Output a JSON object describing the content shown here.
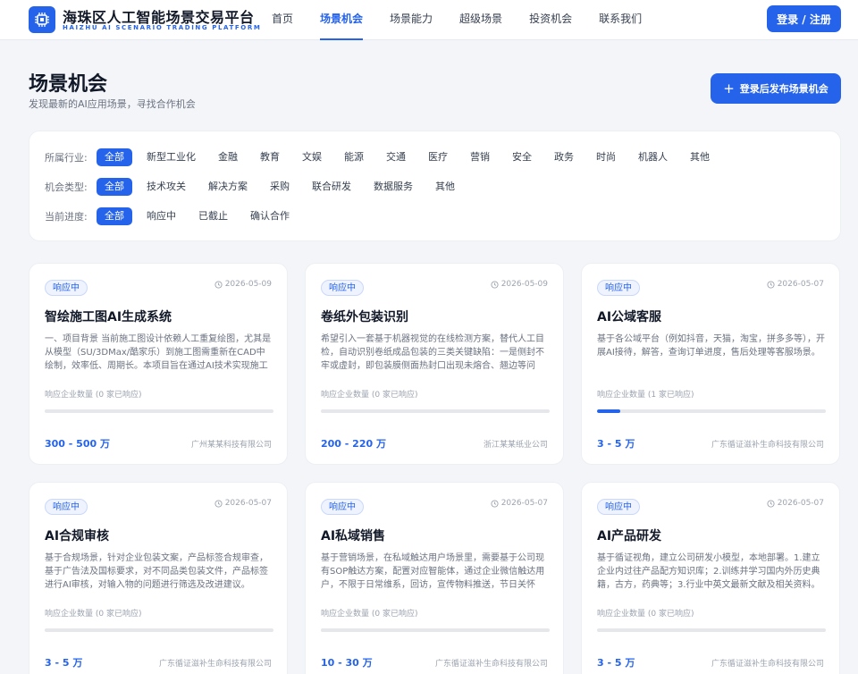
{
  "header": {
    "logo_icon": "chip-icon",
    "brand_cn": "海珠区人工智能场景交易平台",
    "brand_en": "HAIZHU AI SCENARIO TRADING PLATFORM",
    "nav": [
      "首页",
      "场景机会",
      "场景能力",
      "超级场景",
      "投资机会",
      "联系我们"
    ],
    "nav_active": "场景机会",
    "login_label": "登录 / 注册",
    "accent_color": "#2563eb"
  },
  "page": {
    "title": "场景机会",
    "subtitle": "发现最新的AI应用场景，寻找合作机会",
    "publish_label": "登录后发布场景机会"
  },
  "filters": {
    "industry": {
      "label": "所属行业:",
      "options": [
        "全部",
        "新型工业化",
        "金融",
        "教育",
        "文娱",
        "能源",
        "交通",
        "医疗",
        "营销",
        "安全",
        "政务",
        "时尚",
        "机器人",
        "其他"
      ],
      "selected": "全部"
    },
    "type": {
      "label": "机会类型:",
      "options": [
        "全部",
        "技术攻关",
        "解决方案",
        "采购",
        "联合研发",
        "数据服务",
        "其他"
      ],
      "selected": "全部"
    },
    "progress": {
      "label": "当前进度:",
      "options": [
        "全部",
        "响应中",
        "已截止",
        "确认合作"
      ],
      "selected": "全部"
    }
  },
  "cards": [
    {
      "status": "响应中",
      "date": "2026-05-09",
      "title": "智绘施工图AI生成系统",
      "desc": "一、项目背景 当前施工图设计依赖人工重复绘图，尤其是从模型（SU/3DMax/酷家乐）到施工图需重新在CAD中绘制，效率低、周期长。本项目旨在通过AI技术实现施工图的智能生成。",
      "responses": "响应企业数量 (0 家已响应)",
      "progress": 0,
      "price": "300 - 500 万",
      "company": "广州某某科技有限公司"
    },
    {
      "status": "响应中",
      "date": "2026-05-09",
      "title": "卷纸外包装识别",
      "desc": "希望引入一套基于机器视觉的在线检测方案，替代人工目检，自动识别卷纸成品包装的三类关键缺陷：一是侧封不牢或虚封，即包装膜侧面热封口出现未熔合、翘边等问题。",
      "responses": "响应企业数量 (0 家已响应)",
      "progress": 0,
      "price": "200 - 220 万",
      "company": "浙江某某纸业公司"
    },
    {
      "status": "响应中",
      "date": "2026-05-07",
      "title": "AI公域客服",
      "desc": "基于各公域平台（例如抖音，天猫，淘宝，拼多多等），开展AI接待，解答，查询订单进度，售后处理等客服场景。",
      "responses": "响应企业数量 (1 家已响应)",
      "progress": 0.1,
      "price": "3 - 5 万",
      "company": "广东循证滋补生命科技有限公司"
    },
    {
      "status": "响应中",
      "date": "2026-05-07",
      "title": "AI合规审核",
      "desc": "基于合规场景，针对企业包装文案，产品标签合规审查，基于广告法及国标要求，对不同品类包装文件，产品标签进行AI审核，对输入物的问题进行筛选及改进建议。",
      "responses": "响应企业数量 (0 家已响应)",
      "progress": 0,
      "price": "3 - 5 万",
      "company": "广东循证滋补生命科技有限公司"
    },
    {
      "status": "响应中",
      "date": "2026-05-07",
      "title": "AI私域销售",
      "desc": "基于营销场景，在私域触达用户场景里，需要基于公司现有SOP触达方案，配置对应智能体，通过企业微信触达用户，不限于日常维系，回访，宣传物料推送，节日关怀等。",
      "responses": "响应企业数量 (0 家已响应)",
      "progress": 0,
      "price": "10 - 30 万",
      "company": "广东循证滋补生命科技有限公司"
    },
    {
      "status": "响应中",
      "date": "2026-05-07",
      "title": "AI产品研发",
      "desc": "基于循证视角，建立公司研发小模型，本地部署。1.建立企业内过往产品配方知识库；2.训练并学习国内外历史典籍，古方，药典等；3.行业中英文最新文献及相关资料。",
      "responses": "响应企业数量 (0 家已响应)",
      "progress": 0,
      "price": "3 - 5 万",
      "company": "广东循证滋补生命科技有限公司"
    }
  ]
}
